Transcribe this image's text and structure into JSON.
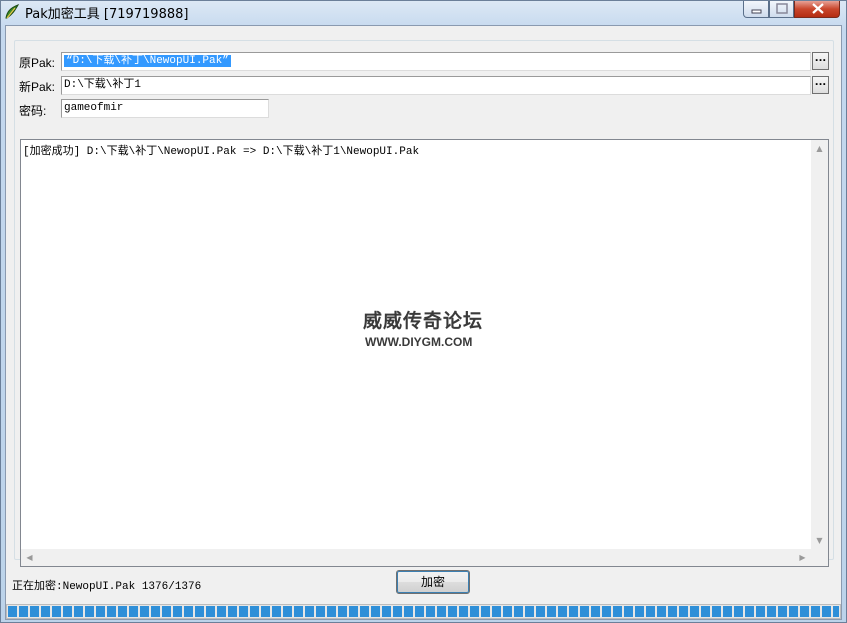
{
  "window": {
    "title": "Pak加密工具 [719719888]"
  },
  "form": {
    "source_label": "原Pak:",
    "source_value": "“D:\\下载\\补丁\\NewopUI.Pak”",
    "dest_label": "新Pak:",
    "dest_value": "D:\\下载\\补丁1",
    "password_label": "密码:",
    "password_value": "gameofmir",
    "browse_label": "..."
  },
  "log": {
    "lines": [
      "[加密成功] D:\\下载\\补丁\\NewopUI.Pak => D:\\下载\\补丁1\\NewopUI.Pak"
    ]
  },
  "watermark": {
    "name": "威威传奇论坛",
    "url": "WWW.DIYGM.COM"
  },
  "status": {
    "text": "正在加密:NewopUI.Pak 1376/1376"
  },
  "actions": {
    "encrypt_label": "加密"
  },
  "progress": {
    "value": 1.0
  },
  "colors": {
    "selection": "#3399ff",
    "progress": "#2f8fd8"
  },
  "icons": {
    "app": "app-leaf-icon",
    "minimize": "minimize-icon",
    "maximize": "maximize-icon",
    "close": "close-icon"
  }
}
